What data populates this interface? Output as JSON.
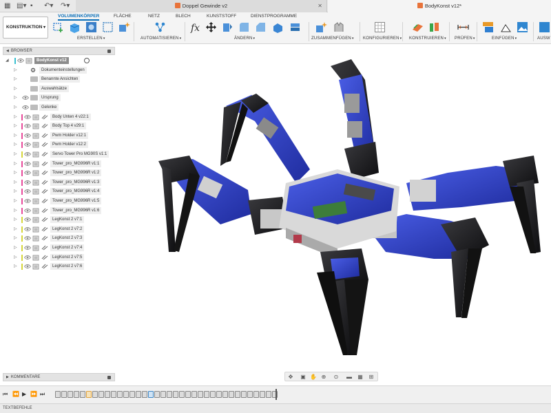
{
  "tabs": [
    {
      "label": "Doppel Gewinde v2",
      "active": false
    },
    {
      "label": "BodyKonst v12*",
      "active": true
    }
  ],
  "ribbon": {
    "workspace": "KONSTRUKTION",
    "tabs": [
      "VOLUMENKÖRPER",
      "FLÄCHE",
      "NETZ",
      "BLECH",
      "KUNSTSTOFF",
      "DIENSTPROGRAMME"
    ],
    "active_tab": "VOLUMENKÖRPER",
    "groups": [
      "ERSTELLEN",
      "AUTOMATISIEREN",
      "ÄNDERN",
      "ZUSAMMENFÜGEN",
      "KONFIGURIEREN",
      "KONSTRUIEREN",
      "PRÜFEN",
      "EINFÜGEN",
      "AUSW"
    ]
  },
  "browser": {
    "title": "BROWSER",
    "items": [
      {
        "label": "BodyKonst v12",
        "kind": "root"
      },
      {
        "label": "Dokumenteinstellungen",
        "kind": "settings"
      },
      {
        "label": "Benannte Ansichten",
        "kind": "folder"
      },
      {
        "label": "Auswahlsätze",
        "kind": "folder"
      },
      {
        "label": "Ursprung",
        "kind": "folder-eye"
      },
      {
        "label": "Gelenke",
        "kind": "folder-eye"
      },
      {
        "label": "Body Unten 4 v22:1",
        "kind": "component",
        "color": "#e84a9a"
      },
      {
        "label": "Body Top 4 v29:1",
        "kind": "component",
        "color": "#e84a9a"
      },
      {
        "label": "Pwm Holder v12:1",
        "kind": "component",
        "color": "#e84a9a"
      },
      {
        "label": "Pwm Holder v12:2",
        "kind": "component",
        "color": "#e84a9a"
      },
      {
        "label": "Servo Tower Pro MG90S v1:1",
        "kind": "component",
        "color": "#d7d63a"
      },
      {
        "label": "Tower_pro_MG996R v1:1",
        "kind": "component",
        "color": "#e84a9a"
      },
      {
        "label": "Tower_pro_MG996R v1:2",
        "kind": "component",
        "color": "#e84a9a"
      },
      {
        "label": "Tower_pro_MG996R v1:3",
        "kind": "component",
        "color": "#e84a9a"
      },
      {
        "label": "Tower_pro_MG996R v1:4",
        "kind": "component",
        "color": "#e84a9a"
      },
      {
        "label": "Tower_pro_MG996R v1:5",
        "kind": "component",
        "color": "#e84a9a"
      },
      {
        "label": "Tower_pro_MG996R v1:6",
        "kind": "component",
        "color": "#e84a9a"
      },
      {
        "label": "LegKonst 2 v7:1",
        "kind": "component",
        "color": "#d7d63a"
      },
      {
        "label": "LegKonst 2 v7:2",
        "kind": "component",
        "color": "#d7d63a"
      },
      {
        "label": "LegKonst 2 v7:3",
        "kind": "component",
        "color": "#d7d63a"
      },
      {
        "label": "LegKonst 2 v7:4",
        "kind": "component",
        "color": "#d7d63a"
      },
      {
        "label": "LegKonst 2 v7:5",
        "kind": "component",
        "color": "#d7d63a"
      },
      {
        "label": "LegKonst 2 v7:6",
        "kind": "component",
        "color": "#d7d63a"
      }
    ]
  },
  "comments": {
    "title": "KOMMENTARE"
  },
  "textcommands": {
    "title": "TEXTBEFEHLE"
  },
  "colors": {
    "accent": "#0b6fb8",
    "robot_blue": "#2b3fc4",
    "robot_black": "#1b1b1d",
    "servo_grey": "#cfcfcf"
  }
}
